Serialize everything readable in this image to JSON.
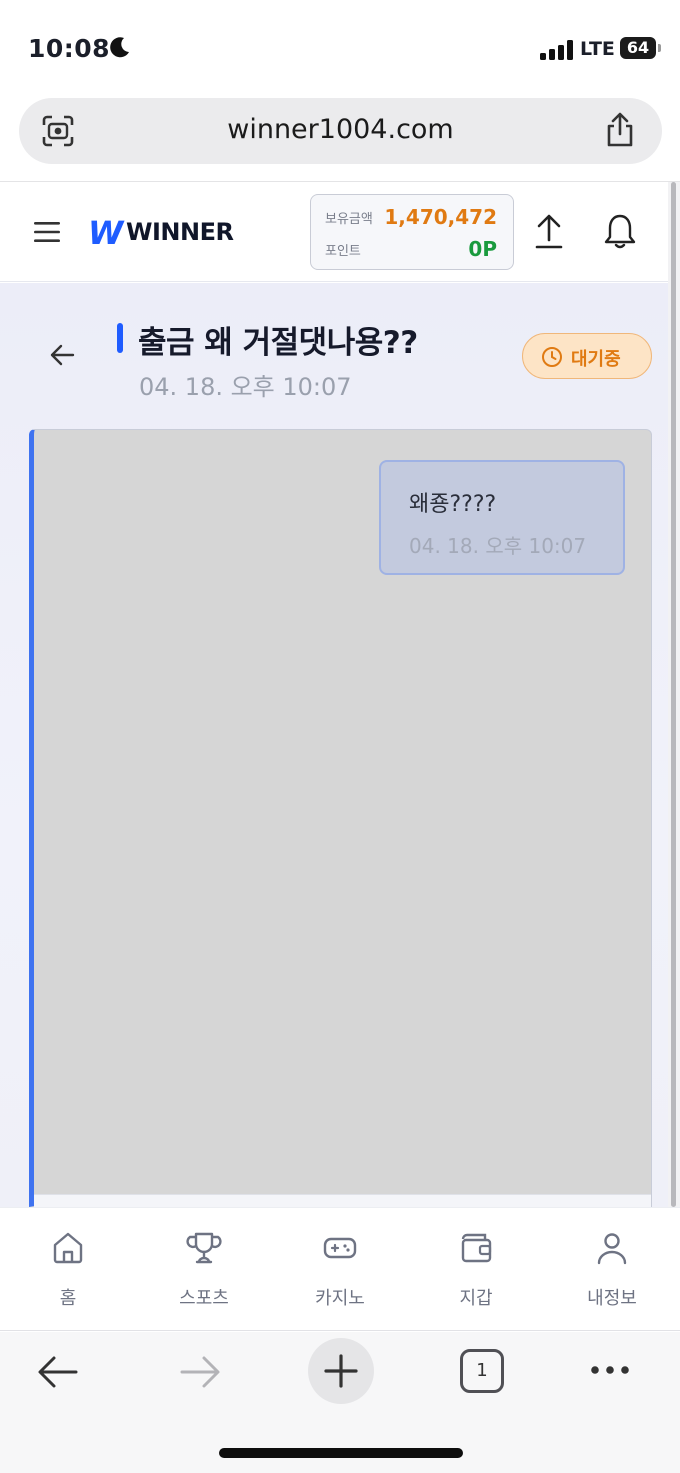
{
  "status_bar": {
    "time": "10:08",
    "network": "LTE",
    "battery": "64",
    "icons": [
      "moon-icon",
      "signal-icon"
    ]
  },
  "browser": {
    "url": "winner1004.com",
    "tab_count": "1",
    "icons": [
      "camera-icon",
      "share-icon",
      "back-icon",
      "forward-icon",
      "plus-icon",
      "more-icon"
    ]
  },
  "header": {
    "logo_mark": "W",
    "logo_text": "WINNER",
    "balance_label": "보유금액",
    "balance_value": "1,470,472",
    "points_label": "포인트",
    "points_value": "0P",
    "colors": {
      "balance": "#e07a12",
      "points": "#199a3d",
      "brand": "#1f5cff"
    }
  },
  "post": {
    "title": "출금 왜 거절댓나용??",
    "date": "04. 18. 오후 10:07",
    "status": "대기중",
    "status_color": "#e07a12"
  },
  "messages": [
    {
      "text": "왜죵????",
      "time": "04. 18. 오후 10:07"
    }
  ],
  "bottom_nav": [
    {
      "label": "홈",
      "icon": "home-icon"
    },
    {
      "label": "스포츠",
      "icon": "trophy-icon"
    },
    {
      "label": "카지노",
      "icon": "gamepad-icon"
    },
    {
      "label": "지갑",
      "icon": "wallet-icon"
    },
    {
      "label": "내정보",
      "icon": "user-icon"
    }
  ]
}
